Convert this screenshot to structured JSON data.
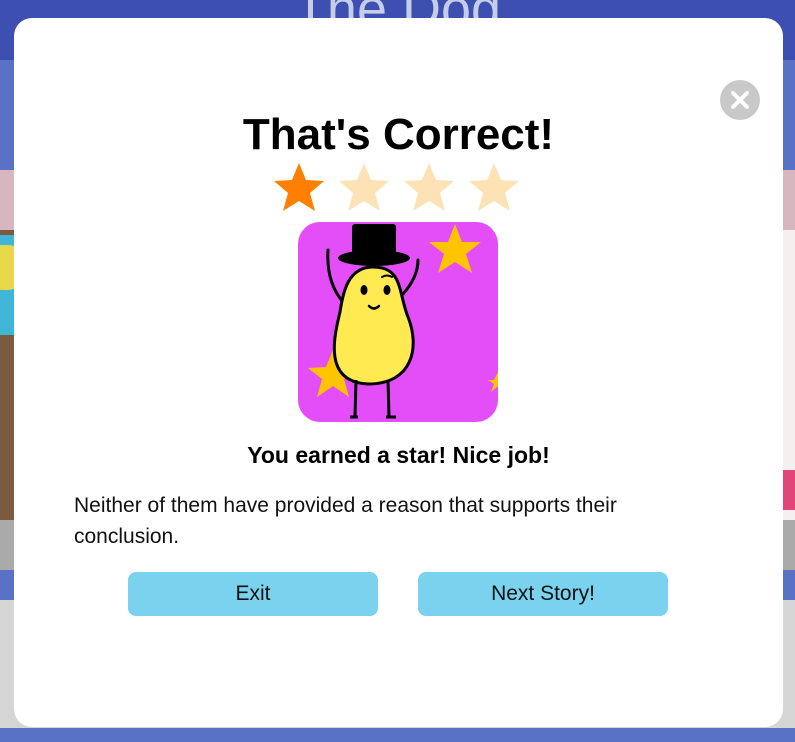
{
  "background": {
    "title": "The Dog"
  },
  "modal": {
    "title": "That's Correct!",
    "stars": {
      "earned": 1,
      "total": 4
    },
    "colors": {
      "star_earned": "#ff7f00",
      "star_empty": "#fde2b6",
      "image_bg": "#e34ef8",
      "button_bg": "#7ad2ee"
    },
    "subtitle": "You earned a star! Nice job!",
    "feedback": "Neither of them have provided a reason that supports their conclusion.",
    "buttons": {
      "exit_label": "Exit",
      "next_label": "Next Story!"
    },
    "icons": {
      "close": "close-icon",
      "reward": "potato-mascot-with-top-hat"
    }
  }
}
